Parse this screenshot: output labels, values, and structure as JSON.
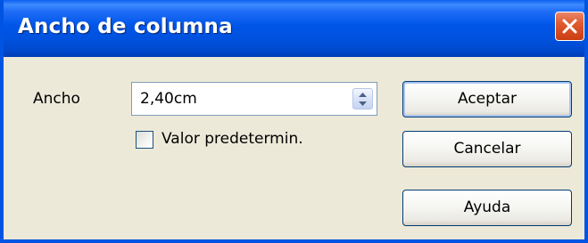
{
  "window": {
    "title": "Ancho de columna"
  },
  "form": {
    "width_label": "Ancho",
    "width_value": "2,40cm",
    "default_checkbox_label": "Valor predetermin.",
    "default_checkbox_checked": false
  },
  "buttons": {
    "accept": "Aceptar",
    "cancel": "Cancelar",
    "help": "Ayuda"
  },
  "icons": {
    "close": "close-icon",
    "spin": "spin-arrows-icon"
  },
  "colors": {
    "titlebar": "#0055e8",
    "close_button": "#e05a30",
    "dialog_background": "#ece9d8",
    "button_border": "#003c74"
  }
}
